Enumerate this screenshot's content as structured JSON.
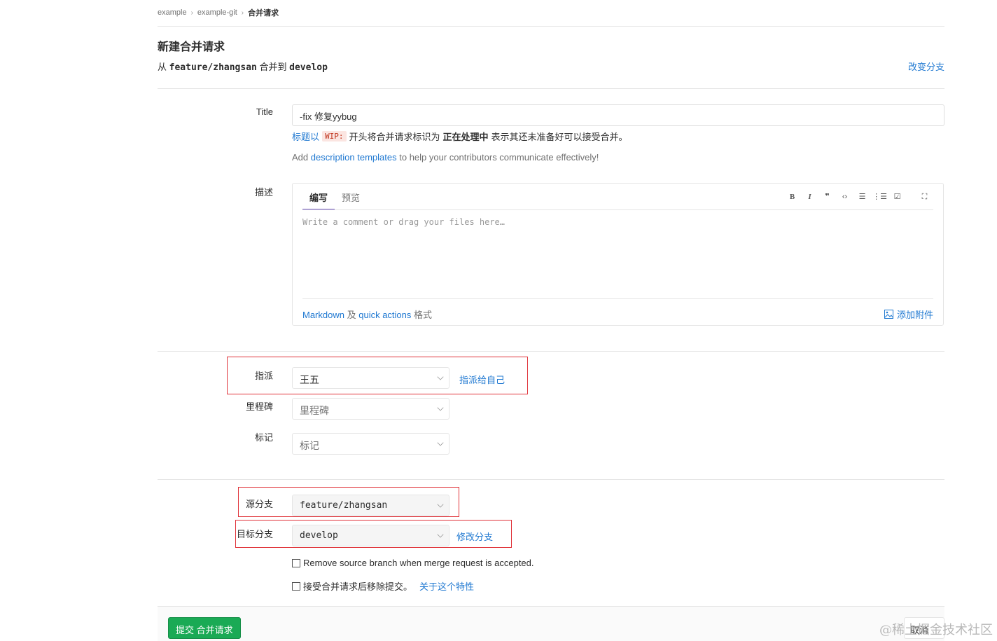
{
  "breadcrumb": {
    "items": [
      "example",
      "example-git"
    ],
    "current": "合并请求"
  },
  "header": {
    "title": "新建合并请求",
    "from_prefix": "从",
    "source_branch": "feature/zhangsan",
    "merge_into": "合并到",
    "target_branch": "develop",
    "change_branches": "改变分支"
  },
  "title_field": {
    "label": "Title",
    "value": "-fix 修复yybug",
    "hint_link": "标题以",
    "hint_code": "WIP:",
    "hint_mid": "开头将合并请求标识为",
    "hint_bold": "正在处理中",
    "hint_end": "表示其还未准备好可以接受合并。"
  },
  "templates_hint": {
    "prefix": "Add",
    "link": "description templates",
    "suffix": "to help your contributors communicate effectively!"
  },
  "description": {
    "label": "描述",
    "tab_write": "编写",
    "tab_preview": "预览",
    "placeholder": "Write a comment or drag your files here…",
    "toolbar": [
      "bold-icon",
      "italic-icon",
      "quote-icon",
      "code-icon",
      "bullet-list-icon",
      "numbered-list-icon",
      "task-list-icon",
      "fullscreen-icon"
    ],
    "footer_markdown": "Markdown",
    "footer_and": "及",
    "footer_quick_actions": "quick actions",
    "footer_format": "格式",
    "attach": "添加附件"
  },
  "assignee": {
    "label": "指派",
    "value": "王五",
    "assign_self": "指派给自己"
  },
  "milestone": {
    "label": "里程碑",
    "value": "里程碑"
  },
  "labels": {
    "label": "标记",
    "value": "标记"
  },
  "source_branch": {
    "label": "源分支",
    "value": "feature/zhangsan"
  },
  "target_branch": {
    "label": "目标分支",
    "value": "develop",
    "change": "修改分支"
  },
  "options": {
    "remove_source": "Remove source branch when merge request is accepted.",
    "squash": "接受合并请求后移除提交。",
    "squash_link": "关于这个特性"
  },
  "actions": {
    "submit": "提交 合并请求",
    "cancel": "取消"
  },
  "watermark": "@稀土掘金技术社区",
  "colors": {
    "accent": "#1f78d1",
    "submit": "#1aaa55",
    "highlight_box": "#e0333a",
    "active_tab": "#6b4fbb"
  }
}
